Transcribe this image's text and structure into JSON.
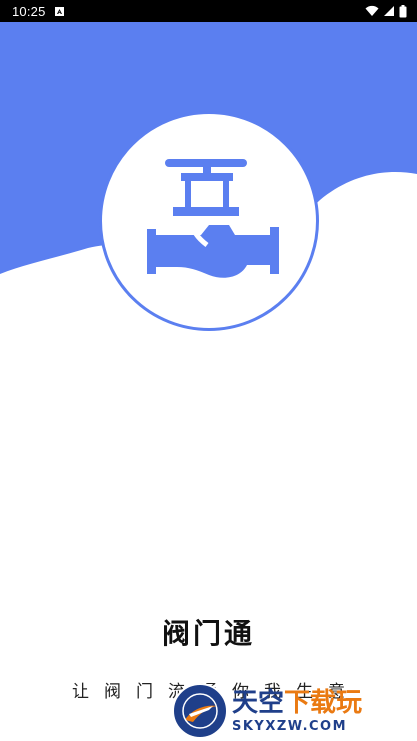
{
  "status_bar": {
    "time": "10:25",
    "notification_icon": "a-notification-icon",
    "icons": [
      "wifi-icon",
      "signal-icon",
      "battery-icon"
    ]
  },
  "splash": {
    "logo_icon": "valve-icon",
    "app_title": "阀门通",
    "slogan": "让阀门流通你我生意"
  },
  "watermark": {
    "brand_part1": "天空",
    "brand_part2": "下载玩",
    "site": "SKYXZW.COM"
  },
  "colors": {
    "hero_blue": "#5b7ff0",
    "wm_blue": "#1f3f8a",
    "wm_orange": "#ea7a12"
  }
}
